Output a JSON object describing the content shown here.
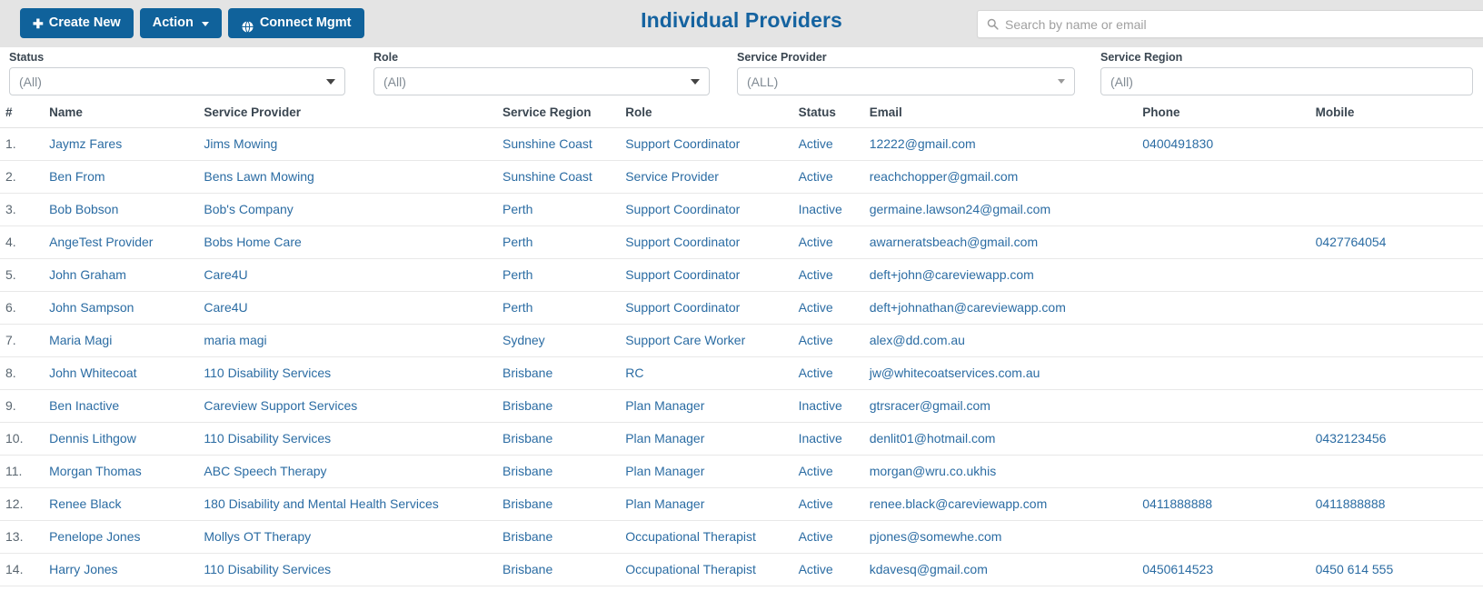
{
  "toolbar": {
    "create_new_label": "Create New",
    "create_new_glyph": "✚",
    "action_label": "Action",
    "connect_mgmt_label": "Connect Mgmt"
  },
  "header": {
    "title": "Individual Providers"
  },
  "search": {
    "placeholder": "Search by name or email",
    "value": ""
  },
  "filters": [
    {
      "label": "Status",
      "value": "(All)"
    },
    {
      "label": "Role",
      "value": "(All)"
    },
    {
      "label": "Service Provider",
      "value": "(ALL)"
    },
    {
      "label": "Service Region",
      "value": "(All)"
    }
  ],
  "table": {
    "columns": [
      "#",
      "Name",
      "Service Provider",
      "Service Region",
      "Role",
      "Status",
      "Email",
      "Phone",
      "Mobile"
    ],
    "rows": [
      {
        "idx": "1.",
        "name": "Jaymz Fares",
        "provider": "Jims Mowing",
        "region": "Sunshine Coast",
        "role": "Support Coordinator",
        "status": "Active",
        "email": "12222@gmail.com",
        "phone": "0400491830",
        "mobile": ""
      },
      {
        "idx": "2.",
        "name": "Ben From",
        "provider": "Bens Lawn Mowing",
        "region": "Sunshine Coast",
        "role": "Service Provider",
        "status": "Active",
        "email": "reachchopper@gmail.com",
        "phone": "",
        "mobile": ""
      },
      {
        "idx": "3.",
        "name": "Bob Bobson",
        "provider": "Bob's Company",
        "region": "Perth",
        "role": "Support Coordinator",
        "status": "Inactive",
        "email": "germaine.lawson24@gmail.com",
        "phone": "",
        "mobile": ""
      },
      {
        "idx": "4.",
        "name": "AngeTest Provider",
        "provider": "Bobs Home Care",
        "region": "Perth",
        "role": "Support Coordinator",
        "status": "Active",
        "email": "awarneratsbeach@gmail.com",
        "phone": "",
        "mobile": "0427764054"
      },
      {
        "idx": "5.",
        "name": "John Graham",
        "provider": "Care4U",
        "region": "Perth",
        "role": "Support Coordinator",
        "status": "Active",
        "email": "deft+john@careviewapp.com",
        "phone": "",
        "mobile": ""
      },
      {
        "idx": "6.",
        "name": "John Sampson",
        "provider": "Care4U",
        "region": "Perth",
        "role": "Support Coordinator",
        "status": "Active",
        "email": "deft+johnathan@careviewapp.com",
        "phone": "",
        "mobile": ""
      },
      {
        "idx": "7.",
        "name": "Maria Magi",
        "provider": "maria magi",
        "region": "Sydney",
        "role": "Support Care Worker",
        "status": "Active",
        "email": "alex@dd.com.au",
        "phone": "",
        "mobile": ""
      },
      {
        "idx": "8.",
        "name": "John Whitecoat",
        "provider": "110 Disability Services",
        "region": "Brisbane",
        "role": "RC",
        "status": "Active",
        "email": "jw@whitecoatservices.com.au",
        "phone": "",
        "mobile": ""
      },
      {
        "idx": "9.",
        "name": "Ben Inactive",
        "provider": "Careview Support Services",
        "region": "Brisbane",
        "role": "Plan Manager",
        "status": "Inactive",
        "email": "gtrsracer@gmail.com",
        "phone": "",
        "mobile": ""
      },
      {
        "idx": "10.",
        "name": "Dennis Lithgow",
        "provider": "110 Disability Services",
        "region": "Brisbane",
        "role": "Plan Manager",
        "status": "Inactive",
        "email": "denlit01@hotmail.com",
        "phone": "",
        "mobile": "0432123456"
      },
      {
        "idx": "11.",
        "name": "Morgan Thomas",
        "provider": "ABC Speech Therapy",
        "region": "Brisbane",
        "role": "Plan Manager",
        "status": "Active",
        "email": "morgan@wru.co.ukhis",
        "phone": "",
        "mobile": ""
      },
      {
        "idx": "12.",
        "name": "Renee Black",
        "provider": "180 Disability and Mental Health Services",
        "region": "Brisbane",
        "role": "Plan Manager",
        "status": "Active",
        "email": "renee.black@careviewapp.com",
        "phone": "0411888888",
        "mobile": "0411888888"
      },
      {
        "idx": "13.",
        "name": "Penelope Jones",
        "provider": "Mollys OT Therapy",
        "region": "Brisbane",
        "role": "Occupational Therapist",
        "status": "Active",
        "email": "pjones@somewhe.com",
        "phone": "",
        "mobile": ""
      },
      {
        "idx": "14.",
        "name": "Harry Jones",
        "provider": "110 Disability Services",
        "region": "Brisbane",
        "role": "Occupational Therapist",
        "status": "Active",
        "email": "kdavesq@gmail.com",
        "phone": "0450614523",
        "mobile": "0450 614 555"
      }
    ]
  },
  "colors": {
    "primary": "#10629b",
    "link": "#2b6ca3",
    "title": "#1563a0",
    "topbar_bg": "#e4e4e4"
  }
}
